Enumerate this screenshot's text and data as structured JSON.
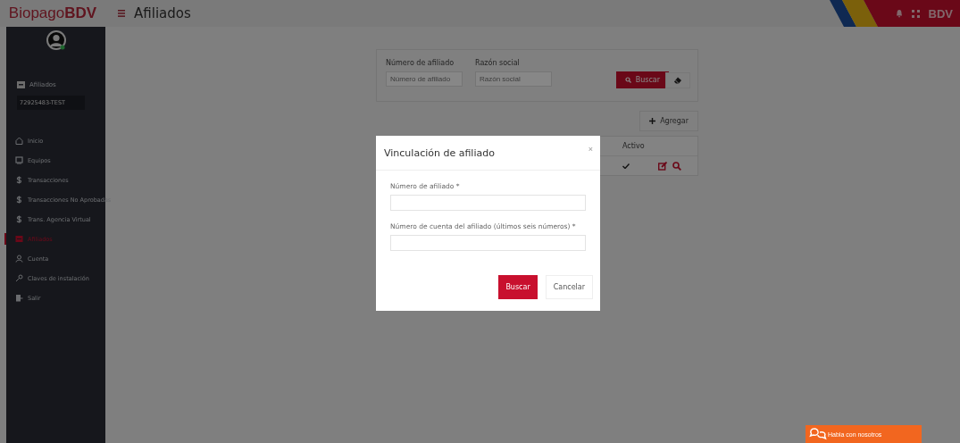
{
  "header": {
    "brand": "Biopago**BDV**",
    "page_title": "Afiliados",
    "logo_text": "BDV"
  },
  "sidebar": {
    "section_label": "Afiliados",
    "affiliate_code": "72925483-TEST",
    "items": [
      {
        "label": "Inicio",
        "kind": "home",
        "selected": false
      },
      {
        "label": "Equipos",
        "kind": "device",
        "selected": false
      },
      {
        "label": "Transacciones",
        "kind": "money",
        "selected": false
      },
      {
        "label": "Transacciones No Aprobadas",
        "kind": "money",
        "selected": false
      },
      {
        "label": "Trans. Agencia Virtual",
        "kind": "money",
        "selected": false
      },
      {
        "label": "Afiliados",
        "kind": "store",
        "selected": true
      },
      {
        "label": "Cuenta",
        "kind": "user",
        "selected": false
      },
      {
        "label": "Claves de instalación",
        "kind": "key",
        "selected": false
      },
      {
        "label": "Salir",
        "kind": "exit",
        "selected": false
      }
    ]
  },
  "filters": {
    "fields": [
      {
        "label": "Número de afiliado",
        "placeholder": "Número de afiliado"
      },
      {
        "label": "Razón social",
        "placeholder": "Razón social"
      }
    ],
    "search_button": "Buscar"
  },
  "add_button": "Agregar",
  "table": {
    "columns": [
      "Activo"
    ],
    "rows": [
      {
        "active": true
      }
    ]
  },
  "modal": {
    "title": "Vinculación de afiliado",
    "close": "×",
    "fields": [
      {
        "label": "Número de afiliado *"
      },
      {
        "label": "Número de cuenta del afiliado (últimos seis números) *"
      }
    ],
    "buttons": [
      {
        "label": "Buscar",
        "kind": "primary"
      },
      {
        "label": "Cancelar",
        "kind": "secondary"
      }
    ]
  },
  "chat": {
    "label": "Habla con nosotros"
  }
}
